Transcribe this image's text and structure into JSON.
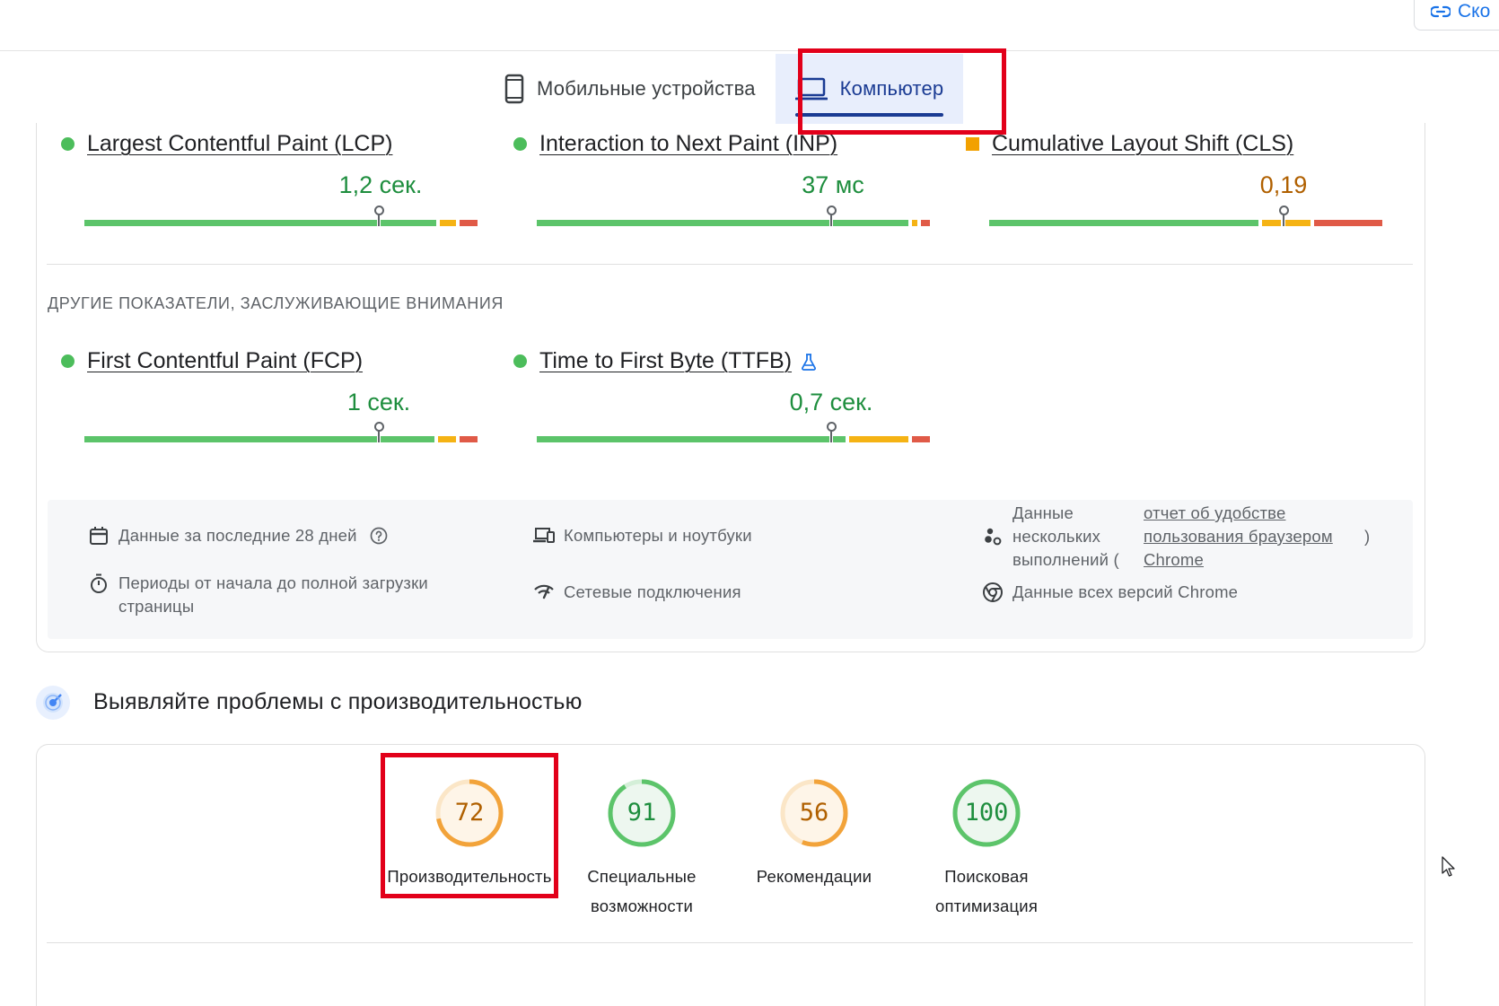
{
  "header": {
    "copy_link_label": "Ско",
    "copy_link_icon": "link-icon"
  },
  "tabs": [
    {
      "label": "Мобильные устройства",
      "icon": "smartphone-icon",
      "active": false
    },
    {
      "label": "Компьютер",
      "icon": "laptop-icon",
      "active": true
    }
  ],
  "core_metrics": [
    {
      "name": "Largest Contentful Paint (LCP)",
      "value": "1,2 сек.",
      "status": "good",
      "status_icon": "green-circle"
    },
    {
      "name": "Interaction to Next Paint (INP)",
      "value": "37 мс",
      "status": "good",
      "status_icon": "green-circle"
    },
    {
      "name": "Cumulative Layout Shift (CLS)",
      "value": "0,19",
      "status": "needs-improvement",
      "status_icon": "orange-square"
    }
  ],
  "other_metrics_title": "ДРУГИЕ ПОКАЗАТЕЛИ, ЗАСЛУЖИВАЮЩИЕ ВНИМАНИЯ",
  "other_metrics": [
    {
      "name": "First Contentful Paint (FCP)",
      "value": "1 сек.",
      "status": "good",
      "status_icon": "green-circle"
    },
    {
      "name": "Time to First Byte (TTFB)",
      "value": "0,7 сек.",
      "status": "good",
      "status_icon": "green-circle",
      "extra_icon": "flask-icon"
    }
  ],
  "info": {
    "period": "Данные за последние 28 дней",
    "devices": "Компьютеры и ноутбуки",
    "samples_prefix": "Данные нескольких выполнений (",
    "samples_link": "отчет об удобстве пользования браузером Chrome",
    "samples_suffix": ")",
    "duration": "Периоды от начала до полной загрузки страницы",
    "network": "Сетевые подключения",
    "chrome_versions": "Данные всех версий Chrome"
  },
  "diagnose": {
    "title": "Выявляйте проблемы с производительностью",
    "icon": "radar-icon"
  },
  "scores": [
    {
      "label": "Производительность",
      "score": "72",
      "value": 72,
      "status": "average"
    },
    {
      "label": "Специальные возможности",
      "score": "91",
      "value": 91,
      "status": "good"
    },
    {
      "label": "Рекомендации",
      "score": "56",
      "value": 56,
      "status": "average"
    },
    {
      "label": "Поисковая оптимизация",
      "score": "100",
      "value": 100,
      "status": "good"
    }
  ],
  "colors": {
    "good": "#1e8e3e",
    "average": "#b06000",
    "good_ring": "#5cc46a",
    "average_ring": "#f2a33a",
    "active_tab": "#1a3b93",
    "highlight": "#e2001a"
  }
}
